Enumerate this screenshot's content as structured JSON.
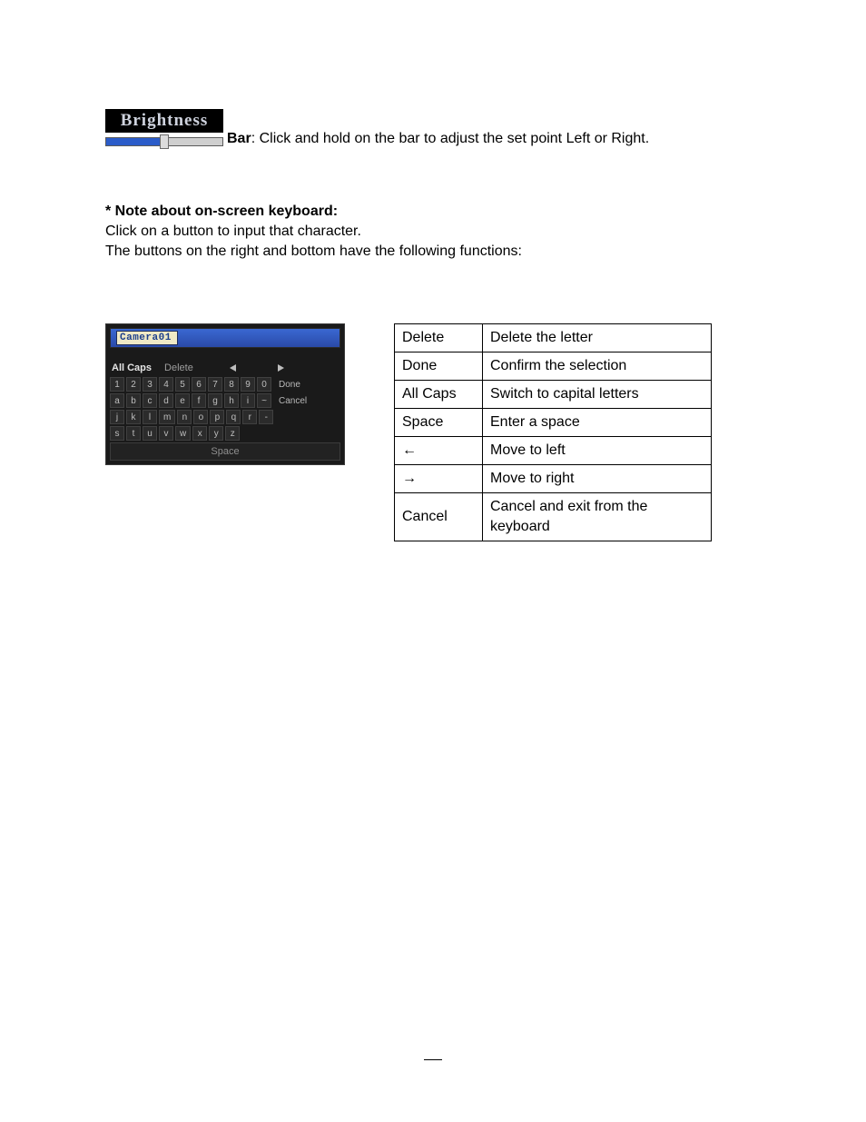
{
  "brightness": {
    "title": "Brightness",
    "bar_label": "Bar",
    "bar_text": ": Click and hold on the bar to adjust the set point Left or Right."
  },
  "note": {
    "heading": "* Note about on-screen keyboard:",
    "line1": "Click on a button to input that character.",
    "line2": "The buttons on the right and bottom have the following functions:"
  },
  "osk": {
    "input_value": "Camera01",
    "controls": {
      "all_caps": "All Caps",
      "delete": "Delete"
    },
    "row_numbers": [
      "1",
      "2",
      "3",
      "4",
      "5",
      "6",
      "7",
      "8",
      "9",
      "0"
    ],
    "row_numbers_action": "Done",
    "row_letters_1": [
      "a",
      "b",
      "c",
      "d",
      "e",
      "f",
      "g",
      "h",
      "i",
      "~"
    ],
    "row_letters_1_action": "Cancel",
    "row_letters_2": [
      "j",
      "k",
      "l",
      "m",
      "n",
      "o",
      "p",
      "q",
      "r",
      "-"
    ],
    "row_letters_3": [
      "s",
      "t",
      "u",
      "v",
      "w",
      "x",
      "y",
      "z"
    ],
    "space_label": "Space"
  },
  "fn_table": [
    {
      "k": "Delete",
      "d": "Delete the letter"
    },
    {
      "k": "Done",
      "d": "Confirm the selection"
    },
    {
      "k": "All Caps",
      "d": "Switch to capital letters"
    },
    {
      "k": "Space",
      "d": "Enter a space"
    },
    {
      "k": "←",
      "d": "Move to left"
    },
    {
      "k": "→",
      "d": "Move to right"
    },
    {
      "k": "Cancel",
      "d": "Cancel and exit from the keyboard"
    }
  ]
}
